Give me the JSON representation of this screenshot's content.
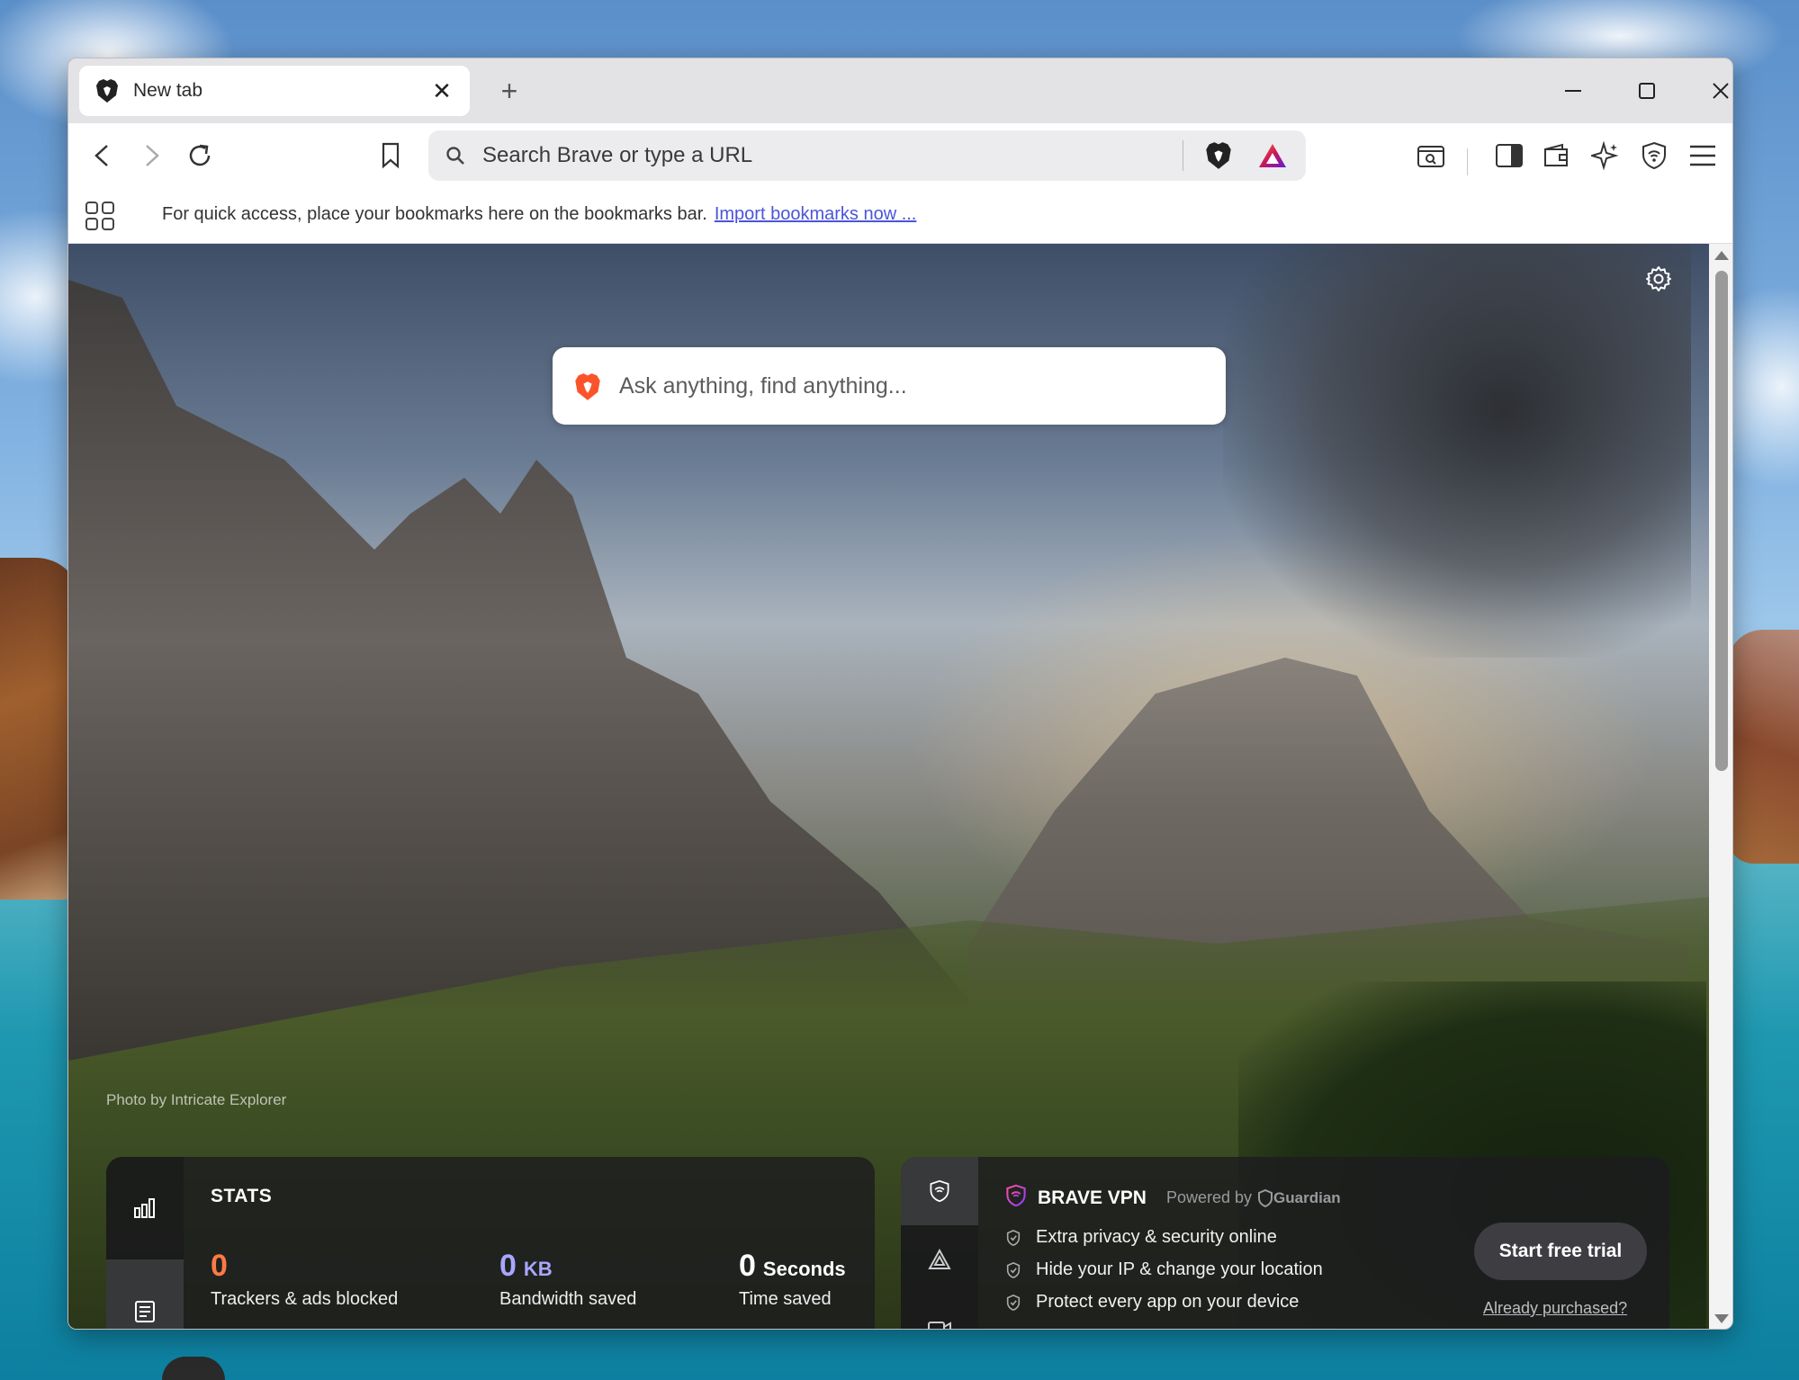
{
  "tab": {
    "title": "New tab"
  },
  "urlbar": {
    "placeholder": "Search Brave or type a URL"
  },
  "bookmarks_bar": {
    "hint": "For quick access, place your bookmarks here on the bookmarks bar.",
    "import_link": "Import bookmarks now ..."
  },
  "ntp": {
    "search_placeholder": "Ask anything, find anything...",
    "photo_credit": "Photo by Intricate Explorer"
  },
  "stats": {
    "heading": "STATS",
    "trackers": {
      "value": "0",
      "label": "Trackers & ads blocked",
      "color": "#ff7a45"
    },
    "bandwidth": {
      "value": "0",
      "unit": "KB",
      "label": "Bandwidth saved",
      "color": "#a9a6ff"
    },
    "time": {
      "value": "0",
      "unit": "Seconds",
      "label": "Time saved"
    }
  },
  "vpn": {
    "name": "BRAVE VPN",
    "powered_by": "Powered by",
    "provider": "Guardian",
    "features": [
      "Extra privacy & security online",
      "Hide your IP & change your location",
      "Protect every app on your device"
    ],
    "cta": "Start free trial",
    "secondary": "Already purchased?"
  },
  "icons": [
    "brave-lion-icon",
    "close-icon",
    "plus-icon",
    "minimize-icon",
    "maximize-icon",
    "back-icon",
    "forward-icon",
    "reload-icon",
    "bookmark-icon",
    "search-icon",
    "brave-shields-icon",
    "brave-rewards-icon",
    "tab-search-icon",
    "sidebar-icon",
    "wallet-icon",
    "leo-ai-icon",
    "vpn-icon",
    "menu-icon",
    "apps-icon",
    "gear-icon",
    "bar-chart-icon",
    "news-icon",
    "talk-icon",
    "shield-check-icon"
  ]
}
